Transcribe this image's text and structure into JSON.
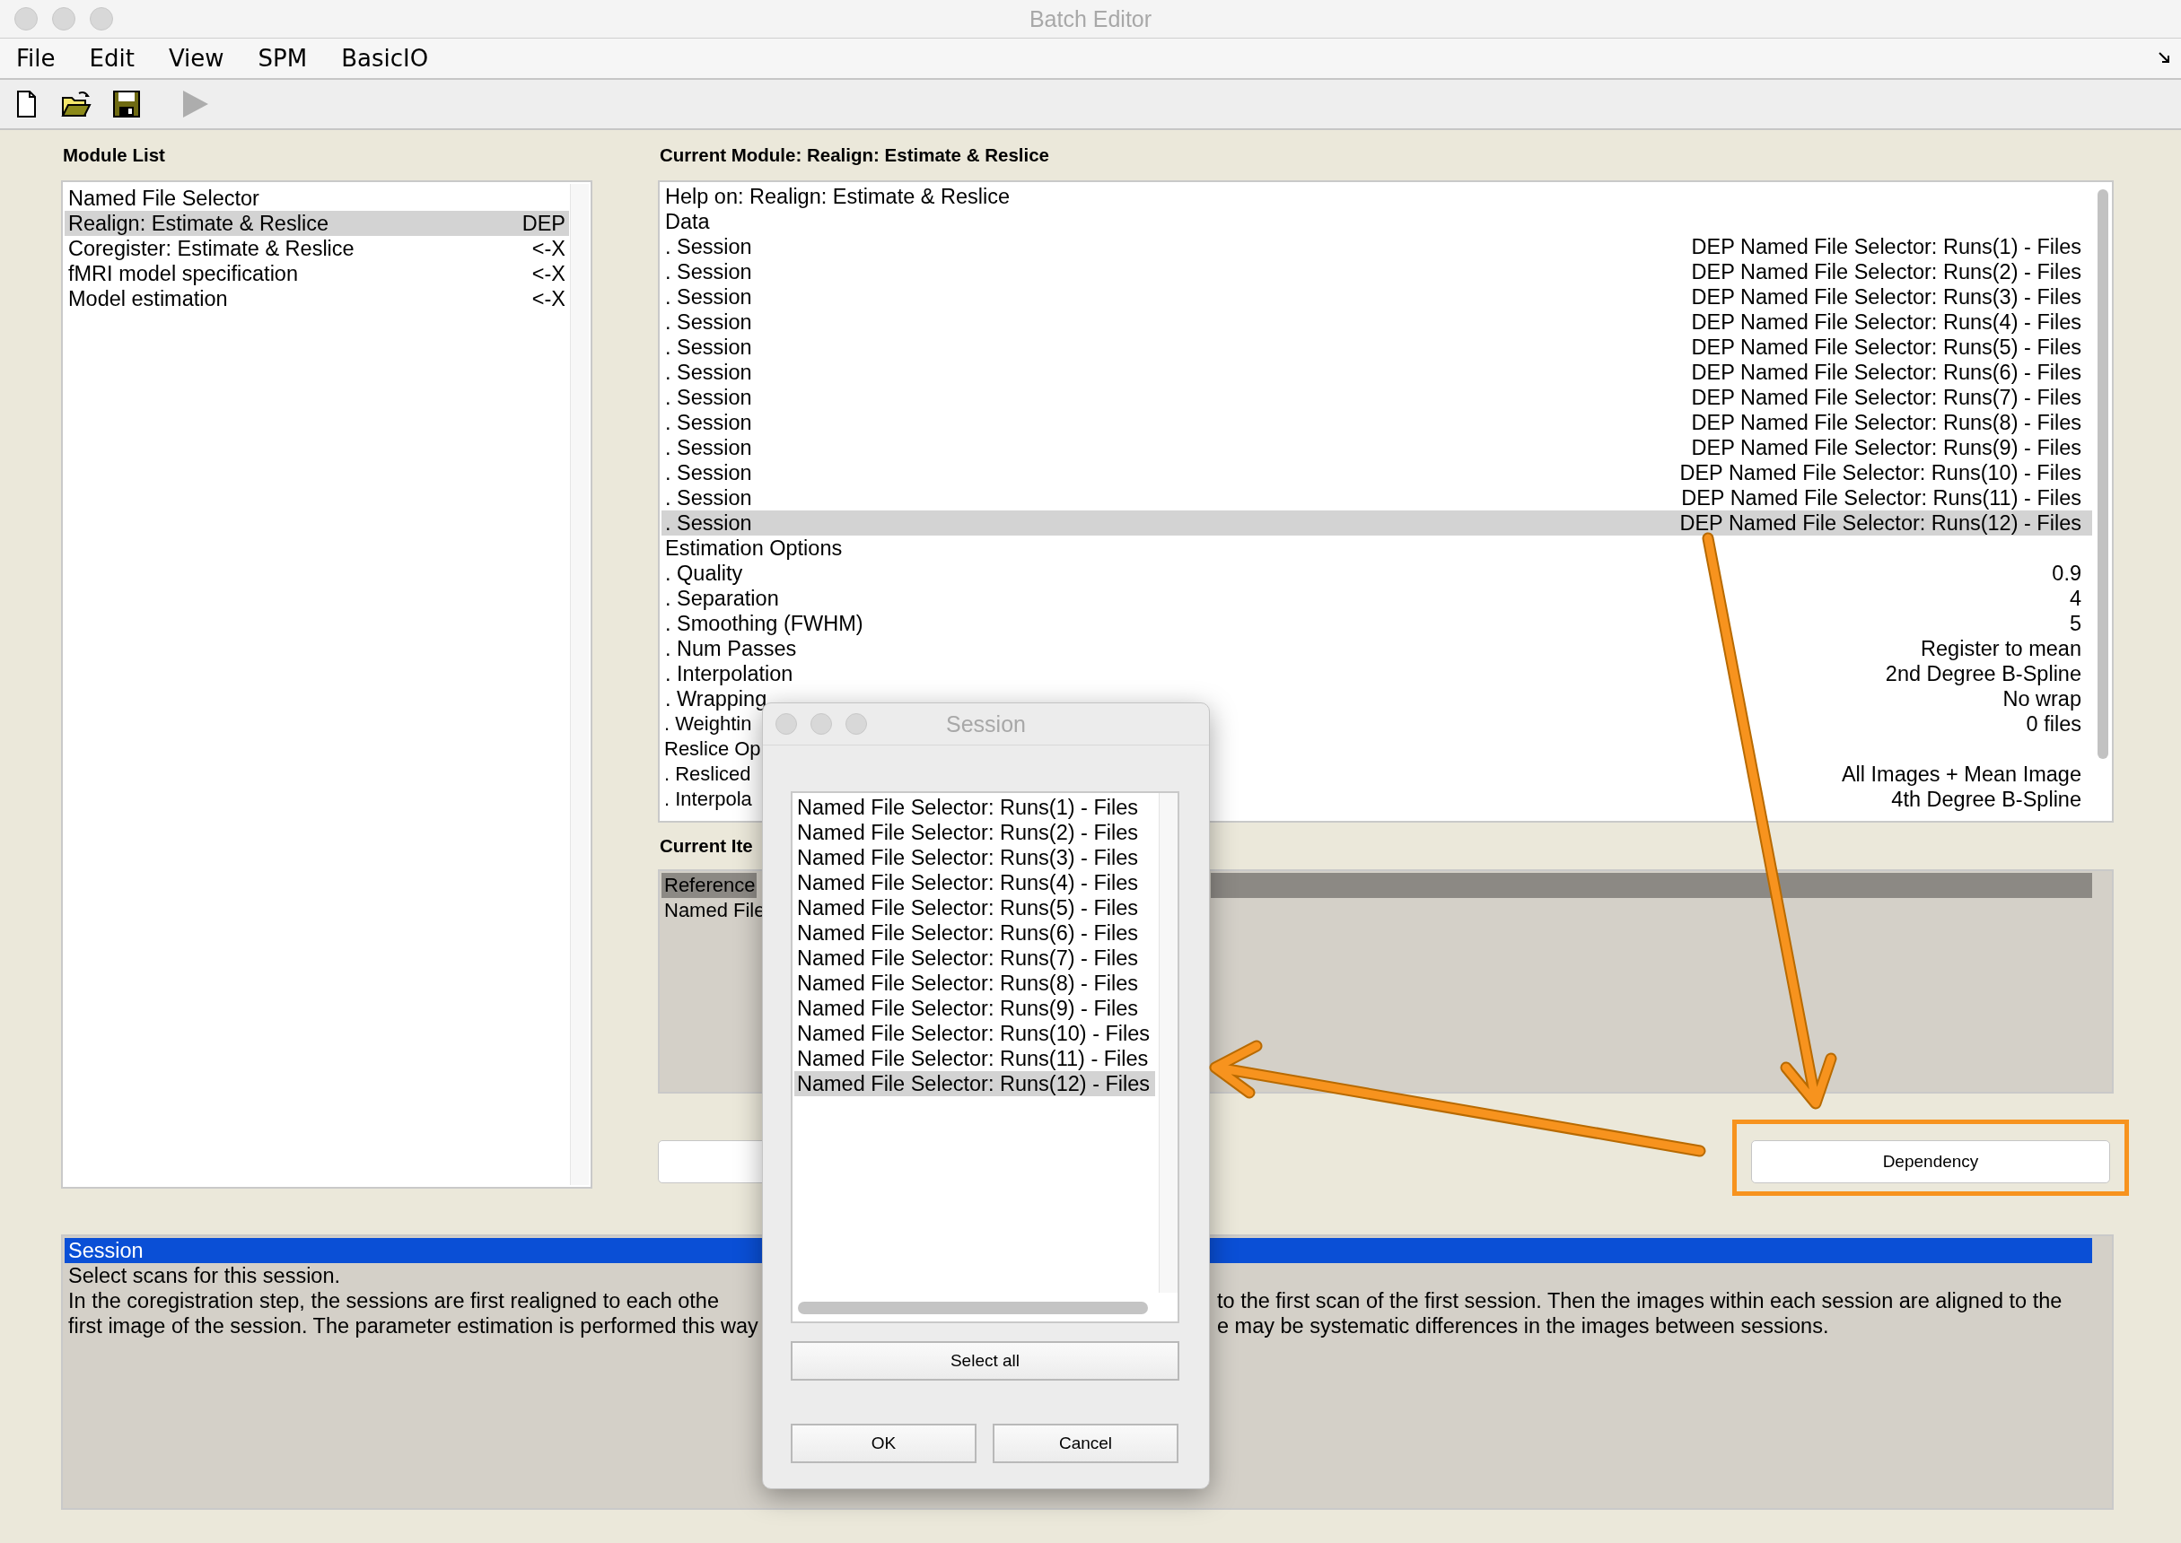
{
  "window": {
    "title": "Batch Editor"
  },
  "menu": [
    "File",
    "Edit",
    "View",
    "SPM",
    "BasicIO"
  ],
  "toolbar": [
    {
      "kind": "new",
      "disabled": false
    },
    {
      "kind": "open",
      "disabled": false
    },
    {
      "kind": "save",
      "disabled": false
    },
    {
      "kind": "run",
      "disabled": true
    }
  ],
  "module_list": {
    "title": "Module List",
    "items": [
      {
        "name": "Named File Selector",
        "selected": false
      },
      {
        "name": "Realign: Estimate & Reslice",
        "status": "DEP",
        "selected": true
      },
      {
        "name": "Coregister: Estimate & Reslice",
        "status": "<-X",
        "selected": false
      },
      {
        "name": "fMRI model specification",
        "status": "<-X",
        "selected": false
      },
      {
        "name": "Model estimation",
        "status": "<-X",
        "selected": false
      }
    ]
  },
  "current_module": {
    "title": "Current Module: Realign: Estimate & Reslice",
    "rows": [
      {
        "label": "Help on: Realign: Estimate & Reslice",
        "selected": false
      },
      {
        "label": "Data",
        "selected": false
      },
      {
        "label": ". Session",
        "value": "DEP Named File Selector: Runs(1) - Files",
        "selected": false
      },
      {
        "label": ". Session",
        "value": "DEP Named File Selector: Runs(2) - Files",
        "selected": false
      },
      {
        "label": ". Session",
        "value": "DEP Named File Selector: Runs(3) - Files",
        "selected": false
      },
      {
        "label": ". Session",
        "value": "DEP Named File Selector: Runs(4) - Files",
        "selected": false
      },
      {
        "label": ". Session",
        "value": "DEP Named File Selector: Runs(5) - Files",
        "selected": false
      },
      {
        "label": ". Session",
        "value": "DEP Named File Selector: Runs(6) - Files",
        "selected": false
      },
      {
        "label": ". Session",
        "value": "DEP Named File Selector: Runs(7) - Files",
        "selected": false
      },
      {
        "label": ". Session",
        "value": "DEP Named File Selector: Runs(8) - Files",
        "selected": false
      },
      {
        "label": ". Session",
        "value": "DEP Named File Selector: Runs(9) - Files",
        "selected": false
      },
      {
        "label": ". Session",
        "value": "DEP Named File Selector: Runs(10) - Files",
        "selected": false
      },
      {
        "label": ". Session",
        "value": "DEP Named File Selector: Runs(11) - Files",
        "selected": false
      },
      {
        "label": ". Session",
        "value": "DEP Named File Selector: Runs(12) - Files",
        "selected": true
      },
      {
        "label": "Estimation Options",
        "selected": false
      },
      {
        "label": ". Quality",
        "value": "0.9",
        "selected": false
      },
      {
        "label": ". Separation",
        "value": "4",
        "selected": false
      },
      {
        "label": ". Smoothing (FWHM)",
        "value": "5",
        "selected": false
      },
      {
        "label": ". Num Passes",
        "value": "Register to mean",
        "selected": false
      },
      {
        "label": ". Interpolation",
        "value": "2nd Degree B-Spline",
        "selected": false
      },
      {
        "label": ". Wrapping",
        "value": "No wrap",
        "selected": false
      },
      {
        "label": ". Weightin",
        "value": "0 files",
        "selected": false
      },
      {
        "label": "Reslice Op",
        "selected": false
      },
      {
        "label": ". Resliced",
        "value": "All Images + Mean Image",
        "selected": false
      },
      {
        "label": ". Interpola",
        "value": "4th Degree B-Spline",
        "selected": false
      }
    ]
  },
  "current_item": {
    "title": "Current Ite",
    "rows": [
      {
        "label": "Reference",
        "selected": true
      },
      {
        "label": "Named File",
        "selected": false
      }
    ]
  },
  "dependency_button": {
    "label": "Dependency"
  },
  "help": {
    "title": "Session",
    "lines": [
      {
        "left": "Select scans for this session."
      },
      {
        "left": "In the coregistration step, the sessions are first realigned to each othe",
        "right": "to the first scan of the first session.  Then the images within each session are aligned to the"
      },
      {
        "left": "first image of the session. The parameter estimation is performed this way",
        "right": "e may be systematic differences in the images between sessions."
      }
    ]
  },
  "dialog": {
    "title": "Session",
    "items": [
      {
        "label": "Named File Selector: Runs(1) - Files",
        "selected": false
      },
      {
        "label": "Named File Selector: Runs(2) - Files",
        "selected": false
      },
      {
        "label": "Named File Selector: Runs(3) - Files",
        "selected": false
      },
      {
        "label": "Named File Selector: Runs(4) - Files",
        "selected": false
      },
      {
        "label": "Named File Selector: Runs(5) - Files",
        "selected": false
      },
      {
        "label": "Named File Selector: Runs(6) - Files",
        "selected": false
      },
      {
        "label": "Named File Selector: Runs(7) - Files",
        "selected": false
      },
      {
        "label": "Named File Selector: Runs(8) - Files",
        "selected": false
      },
      {
        "label": "Named File Selector: Runs(9) - Files",
        "selected": false
      },
      {
        "label": "Named File Selector: Runs(10) - Files",
        "selected": false
      },
      {
        "label": "Named File Selector: Runs(11) - Files",
        "selected": false
      },
      {
        "label": "Named File Selector: Runs(12) - Files",
        "selected": true
      }
    ],
    "select_all": "Select all",
    "ok": "OK",
    "cancel": "Cancel"
  }
}
